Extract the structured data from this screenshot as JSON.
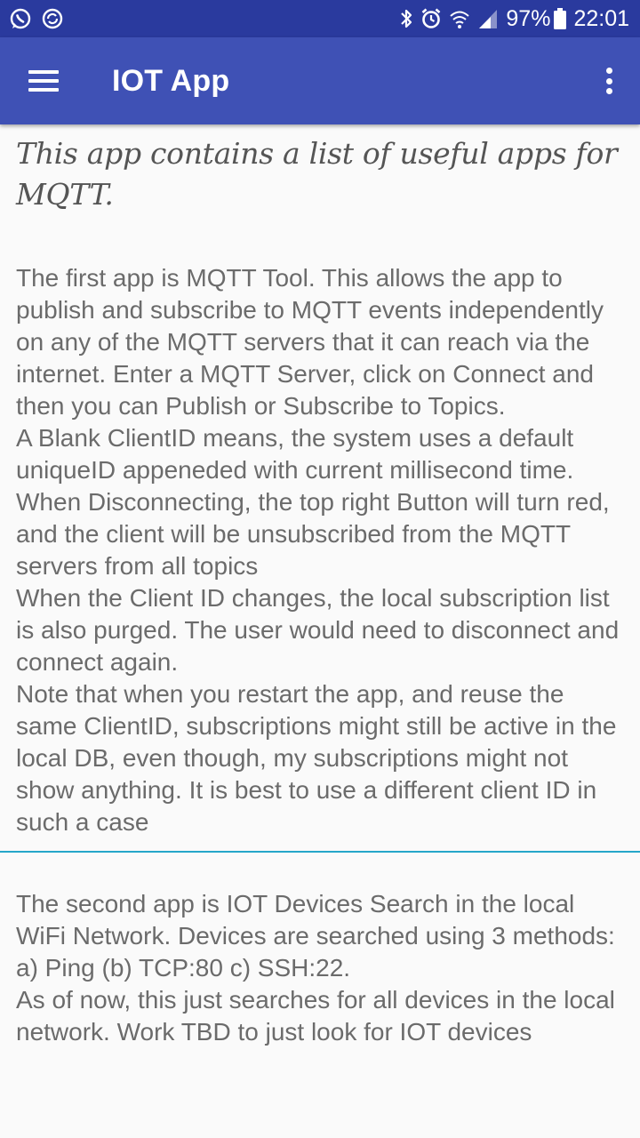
{
  "status_bar": {
    "battery_percent": "97%",
    "time": "22:01",
    "icons": [
      "whatsapp-icon",
      "sync-icon",
      "bluetooth-icon",
      "alarm-icon",
      "wifi-icon",
      "signal-icon",
      "battery-icon"
    ]
  },
  "app_bar": {
    "title": "IOT App",
    "menu_icon": "hamburger-menu-icon",
    "overflow_icon": "more-vert-icon"
  },
  "intro_text": "This app contains a list of useful apps for MQTT.",
  "section1": {
    "paragraphs": [
      "The first app is MQTT Tool. This allows the app to publish and subscribe to MQTT events independently on any of the MQTT servers that it can reach via the internet. Enter a MQTT Server, click on Connect and then you can Publish or Subscribe to Topics.",
      "A Blank ClientID means, the system uses a default uniqueID appeneded with current millisecond time.",
      "When Disconnecting, the top right Button will turn red, and the client will be unsubscribed from the MQTT servers from all topics",
      "When the Client ID changes, the local subscription list is also purged. The user would need to disconnect and connect again.",
      "Note that when you restart the app, and reuse the same ClientID, subscriptions might still be active in the local DB, even though, my subscriptions might not show anything. It is best to use a different client ID in such a case"
    ]
  },
  "section2": {
    "paragraphs": [
      "The second app is IOT Devices Search in the local WiFi Network. Devices are searched using 3 methods: a) Ping (b) TCP:80 c) SSH:22.",
      "As of now, this just searches for all devices in the local network. Work TBD to just look for IOT devices"
    ]
  },
  "colors": {
    "status_bar": "#2a3a9e",
    "app_bar": "#3f51b5",
    "divider": "#26a6c9",
    "body_text": "#6b6b6b",
    "background": "#fafafa"
  }
}
